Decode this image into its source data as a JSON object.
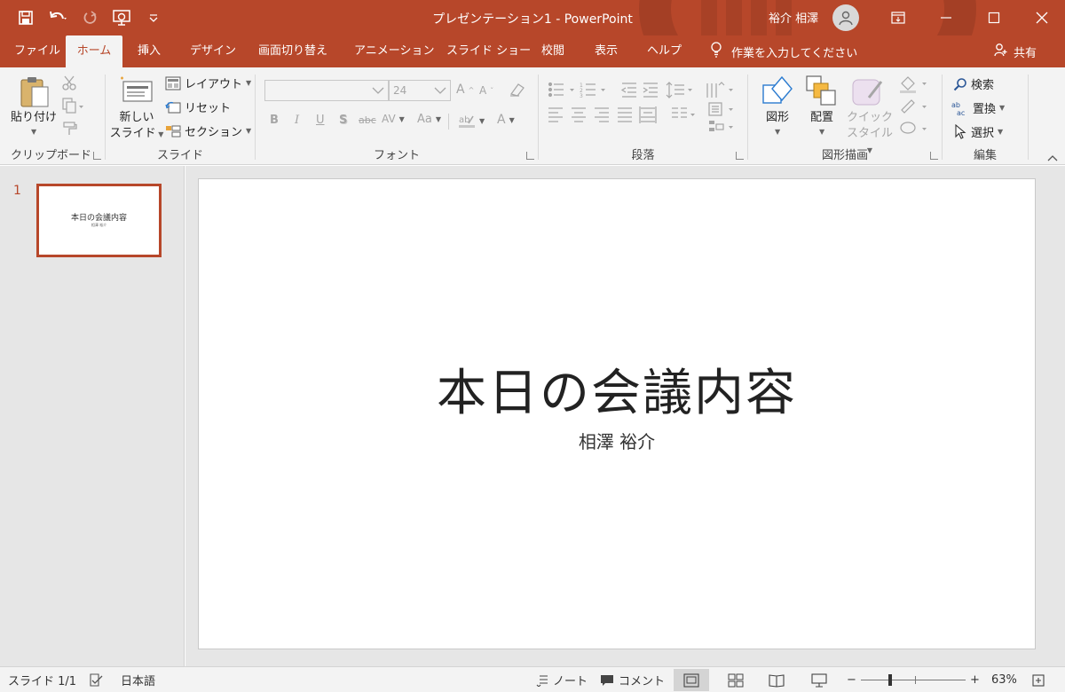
{
  "window": {
    "doc_title": "プレゼンテーション1  -  PowerPoint",
    "user_name": "裕介 相澤"
  },
  "tabs": [
    {
      "label": "ファイル"
    },
    {
      "label": "ホーム",
      "active": true
    },
    {
      "label": "挿入"
    },
    {
      "label": "デザイン"
    },
    {
      "label": "画面切り替え"
    },
    {
      "label": "アニメーション"
    },
    {
      "label": "スライド ショー"
    },
    {
      "label": "校閲"
    },
    {
      "label": "表示"
    },
    {
      "label": "ヘルプ"
    }
  ],
  "tell_me": "作業を入力してください",
  "share_label": "共有",
  "ribbon": {
    "clipboard": {
      "paste": "貼り付け",
      "group": "クリップボード"
    },
    "slides": {
      "new_slide_1": "新しい",
      "new_slide_2": "スライド",
      "layout": "レイアウト",
      "reset": "リセット",
      "section": "セクション",
      "group": "スライド"
    },
    "font": {
      "size": "24",
      "group": "フォント",
      "bold": "B",
      "italic": "I",
      "underline": "U",
      "shadow": "S",
      "strike": "abc",
      "spacing": "AV",
      "case": "Aa",
      "grow": "A",
      "shrink": "A",
      "color": "A"
    },
    "paragraph": {
      "group": "段落"
    },
    "drawing": {
      "shapes": "図形",
      "arrange": "配置",
      "quick_style_1": "クイック",
      "quick_style_2": "スタイル",
      "group": "図形描画"
    },
    "editing": {
      "find": "検索",
      "replace": "置換",
      "select": "選択",
      "group": "編集"
    }
  },
  "slides_pane": {
    "number": "1",
    "thumb_title": "本日の会議内容",
    "thumb_sub": "相澤 裕介"
  },
  "slide": {
    "title": "本日の会議内容",
    "subtitle": "相澤 裕介"
  },
  "status": {
    "slide_count": "スライド 1/1",
    "language": "日本語",
    "notes": "ノート",
    "comments": "コメント",
    "zoom": "63%"
  },
  "colors": {
    "accent": "#b7472a",
    "ribbon_bg": "#f3f3f3",
    "pane_bg": "#e6e6e6"
  }
}
